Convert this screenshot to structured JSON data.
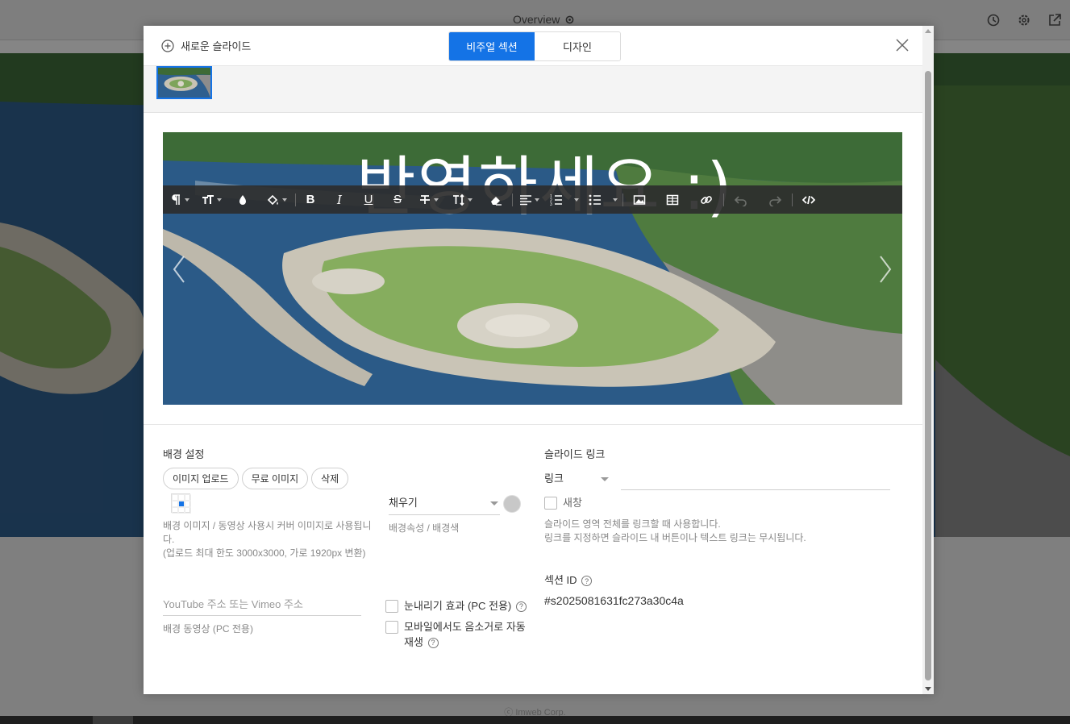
{
  "background": {
    "page_title": "Overview",
    "footer": "ⓒ Imweb Corp."
  },
  "modal": {
    "new_slide_label": "새로운 슬라이드",
    "tabs": [
      {
        "label": "비주얼 섹션",
        "active": true
      },
      {
        "label": "디자인",
        "active": false
      }
    ],
    "preview_text": "반영하세요 :)",
    "toolbar": {
      "tools": [
        "paragraph-icon",
        "text-size-icon",
        "color-drop-icon",
        "fill-bucket-icon",
        "bold-icon",
        "italic-icon",
        "underline-icon",
        "strikethrough-icon",
        "clear-format-icon",
        "line-height-icon",
        "eraser-icon",
        "align-icon",
        "ordered-list-icon",
        "unordered-list-icon",
        "image-icon",
        "table-icon",
        "link-icon",
        "undo-icon",
        "redo-icon",
        "code-icon"
      ]
    },
    "background_settings": {
      "title": "배경 설정",
      "buttons": {
        "upload": "이미지 업로드",
        "free": "무료 이미지",
        "delete": "삭제"
      },
      "hint_line1": "배경 이미지 / 동영상 사용시 커버 이미지로 사용됩니다.",
      "hint_line2": "(업로드 최대 한도 3000x3000, 가로 1920px 변환)",
      "fill_select": "채우기",
      "fill_hint": "배경속성 / 배경색",
      "video_placeholder": "YouTube 주소 또는 Vimeo 주소",
      "video_hint": "배경 동영상 (PC 전용)",
      "snow_effect": "눈내리기 효과 (PC 전용)",
      "mobile_autoplay_line1": "모바일에서도 음소거로 자동",
      "mobile_autoplay_line2": "재생"
    },
    "slide_link": {
      "title": "슬라이드 링크",
      "link_select": "링크",
      "new_window": "새창",
      "hint_line1": "슬라이드 영역 전체를 링크할 때 사용합니다.",
      "hint_line2": "링크를 지정하면 슬라이드 내 버튼이나 텍스트 링크는 무시됩니다."
    },
    "section_id": {
      "title": "섹션 ID",
      "value": "#s2025081631fc273a30c4a"
    }
  },
  "colors": {
    "accent": "#1473e6",
    "fill_color": "#c8c8c8"
  }
}
